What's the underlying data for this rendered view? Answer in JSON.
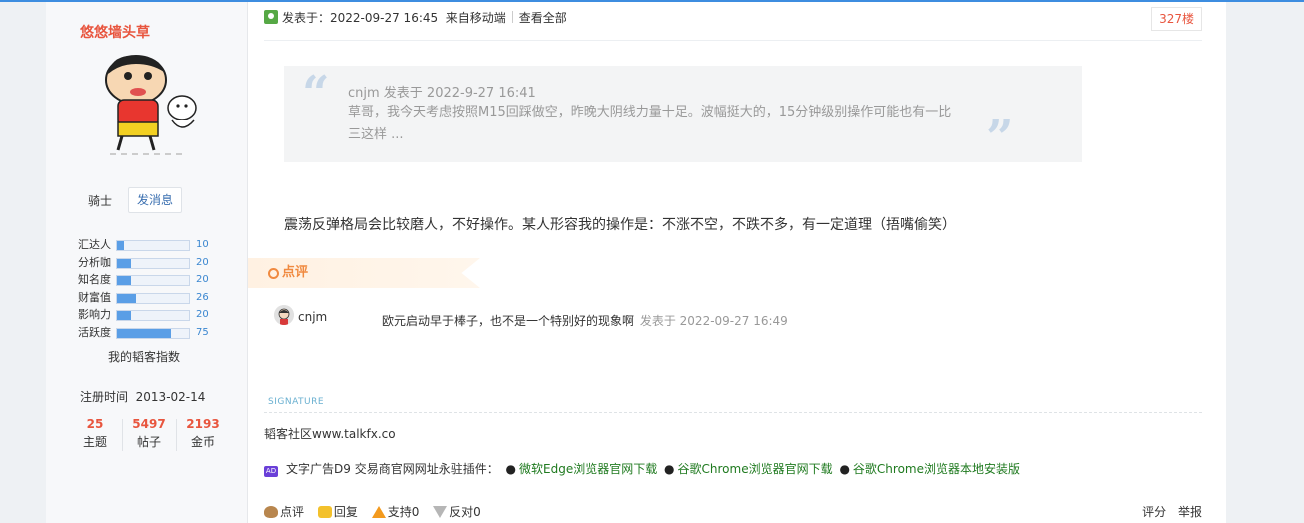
{
  "author": {
    "name": "悠悠墙头草",
    "rank": "骑士",
    "message_button": "发消息",
    "stats": [
      {
        "label": "汇达人",
        "value": 10,
        "fill": 0.1
      },
      {
        "label": "分析咖",
        "value": 20,
        "fill": 0.2
      },
      {
        "label": "知名度",
        "value": 20,
        "fill": 0.2
      },
      {
        "label": "财富值",
        "value": 26,
        "fill": 0.26
      },
      {
        "label": "影响力",
        "value": 20,
        "fill": 0.2
      },
      {
        "label": "活跃度",
        "value": 75,
        "fill": 0.75
      }
    ],
    "index_link": "我的韬客指数",
    "reg_label": "注册时间",
    "reg_date": "2013-02-14",
    "counts": [
      {
        "num": "25",
        "label": "主题"
      },
      {
        "num": "5497",
        "label": "帖子"
      },
      {
        "num": "2193",
        "label": "金币"
      }
    ]
  },
  "post": {
    "posted_at": "发表于：2022-09-27 16:45",
    "source": "来自移动端",
    "view_all": "查看全部",
    "floor": "327楼",
    "quote": {
      "head": "cnjm 发表于 2022-9-27 16:41",
      "text": "草哥，我今天考虑按照M15回踩做空，昨晚大阴线力量十足。波幅挺大的，15分钟级别操作可能也有一比三这样 ..."
    },
    "body": "震荡反弹格局会比较磨人，不好操作。某人形容我的操作是：不涨不空，不跌不多，有一定道理（捂嘴偷笑）",
    "review_label": "点评",
    "comment": {
      "user": "cnjm",
      "text": "欧元启动早于棒子，也不是一个特别好的现象啊",
      "time": "发表于 2022-09-27 16:49"
    },
    "signature_label": "SIGNATURE",
    "signature": "韬客社区www.talkfx.co",
    "ad": {
      "badge": "AD",
      "prefix": "文字广告D9 交易商官网网址永驻插件：",
      "links": [
        "微软Edge浏览器官网下载",
        "谷歌Chrome浏览器官网下载",
        "谷歌Chrome浏览器本地安装版"
      ]
    },
    "actions": {
      "review": "点评",
      "reply": "回复",
      "support": "支持0",
      "oppose": "反对0",
      "rate": "评分",
      "report": "举报"
    }
  }
}
